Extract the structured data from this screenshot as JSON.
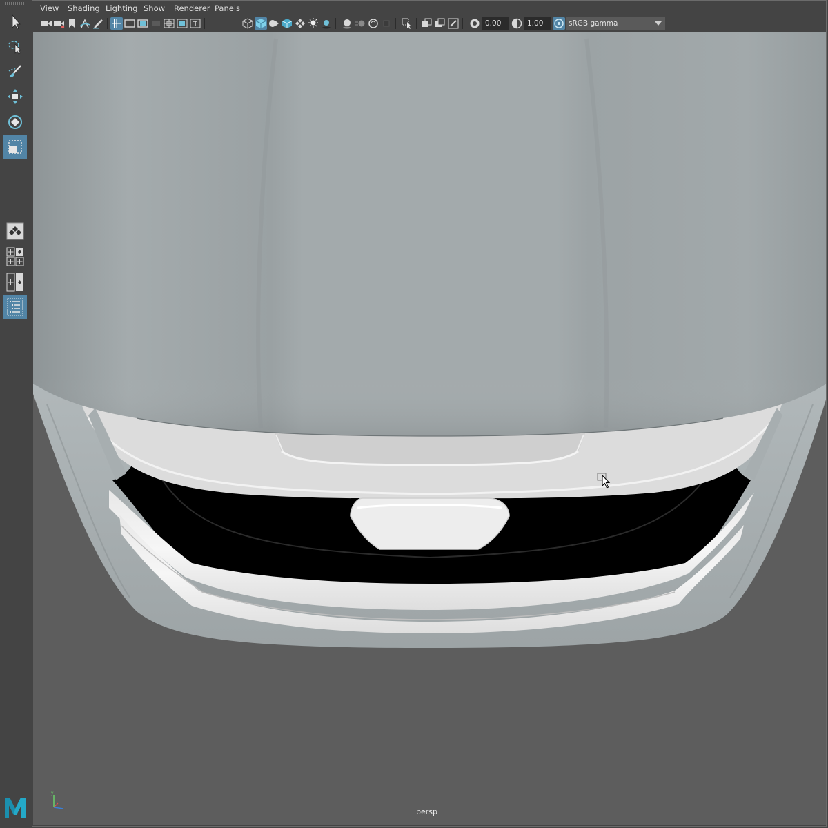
{
  "menubar": {
    "items": [
      "View",
      "Shading",
      "Lighting",
      "Show",
      "Renderer",
      "Panels"
    ]
  },
  "toolbar": {
    "exposure_value": "0.00",
    "gamma_value": "1.00",
    "color_space": "sRGB gamma",
    "icons": [
      "camera-icon",
      "camera-attributes-icon",
      "bookmark-icon",
      "image-plane-icon",
      "grease-pencil-icon",
      "grid-icon",
      "film-gate-icon",
      "resolution-gate-icon",
      "gate-mask-icon",
      "field-chart-icon",
      "safe-action-icon",
      "safe-title-icon",
      "wireframe-icon",
      "smooth-shade-icon",
      "wireframe-on-shaded-icon",
      "textured-icon",
      "checker-icon",
      "lights-icon",
      "shadows-icon",
      "screen-space-ao-icon",
      "motion-blur-icon",
      "anti-aliasing-icon",
      "depth-of-field-icon",
      "isolate-select-icon",
      "xray-icon",
      "xray-joints-icon",
      "xray-active-icon",
      "exposure-icon",
      "gamma-icon",
      "color-management-icon"
    ]
  },
  "toolbox": {
    "tools": [
      "select-tool-icon",
      "lasso-tool-icon",
      "paint-select-tool-icon",
      "move-tool-icon",
      "rotate-tool-icon",
      "scale-tool-icon"
    ],
    "layouts": [
      "single-perspective-layout-icon",
      "four-view-layout-icon",
      "two-pane-layout-icon",
      "outliner-layout-icon"
    ],
    "active_tool": "scale-tool-icon",
    "active_layout": "outliner-layout-icon"
  },
  "viewport": {
    "camera_label": "persp"
  },
  "colors": {
    "accent": "#5285a6",
    "panel_bg": "#444444",
    "viewport_bg": "#5d5d5d",
    "model_surface": "#a0a6a8"
  }
}
